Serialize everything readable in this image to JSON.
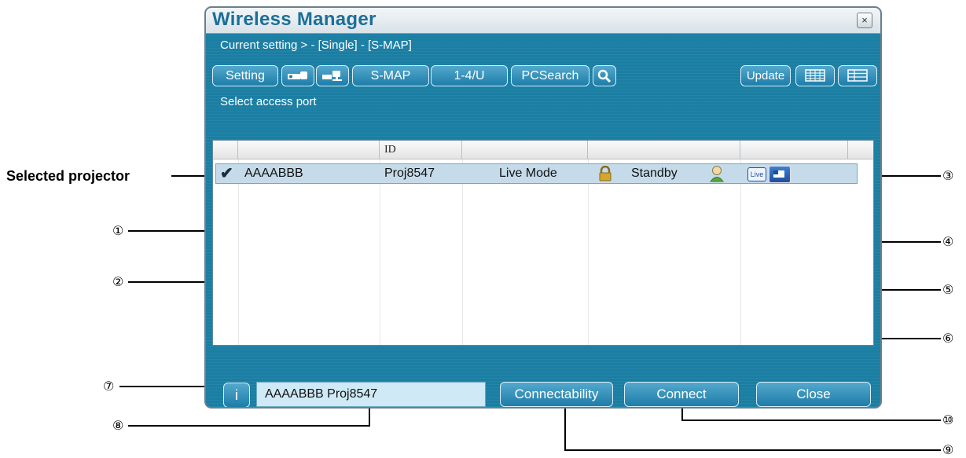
{
  "window": {
    "title": "Wireless Manager",
    "close_glyph": "×",
    "breadcrumb": "Current setting > - [Single] - [S-MAP]",
    "hint": "Select access port"
  },
  "toolbar": {
    "setting": "Setting",
    "smap": "S-MAP",
    "one_to_four": "1-4/U",
    "pcsearch": "PCSearch",
    "update": "Update"
  },
  "list": {
    "columns": [
      "",
      "",
      "ID",
      "",
      "",
      "",
      ""
    ],
    "row": {
      "check": "✔",
      "name": "AAAABBB",
      "id": "Proj8547",
      "mode": "Live Mode",
      "status": "Standby",
      "live_badge": "Live"
    }
  },
  "bottom": {
    "info_label": "i",
    "selected_value": "AAAABBB Proj8547",
    "connectability": "Connectability",
    "connect": "Connect",
    "close": "Close"
  },
  "annotations": {
    "selected_projector": "Selected projector",
    "n1": "①",
    "n2": "②",
    "n3": "③",
    "n4": "④",
    "n5": "⑤",
    "n6": "⑥",
    "n7": "⑦",
    "n8": "⑧",
    "n9": "⑨",
    "n10": "⑩"
  }
}
